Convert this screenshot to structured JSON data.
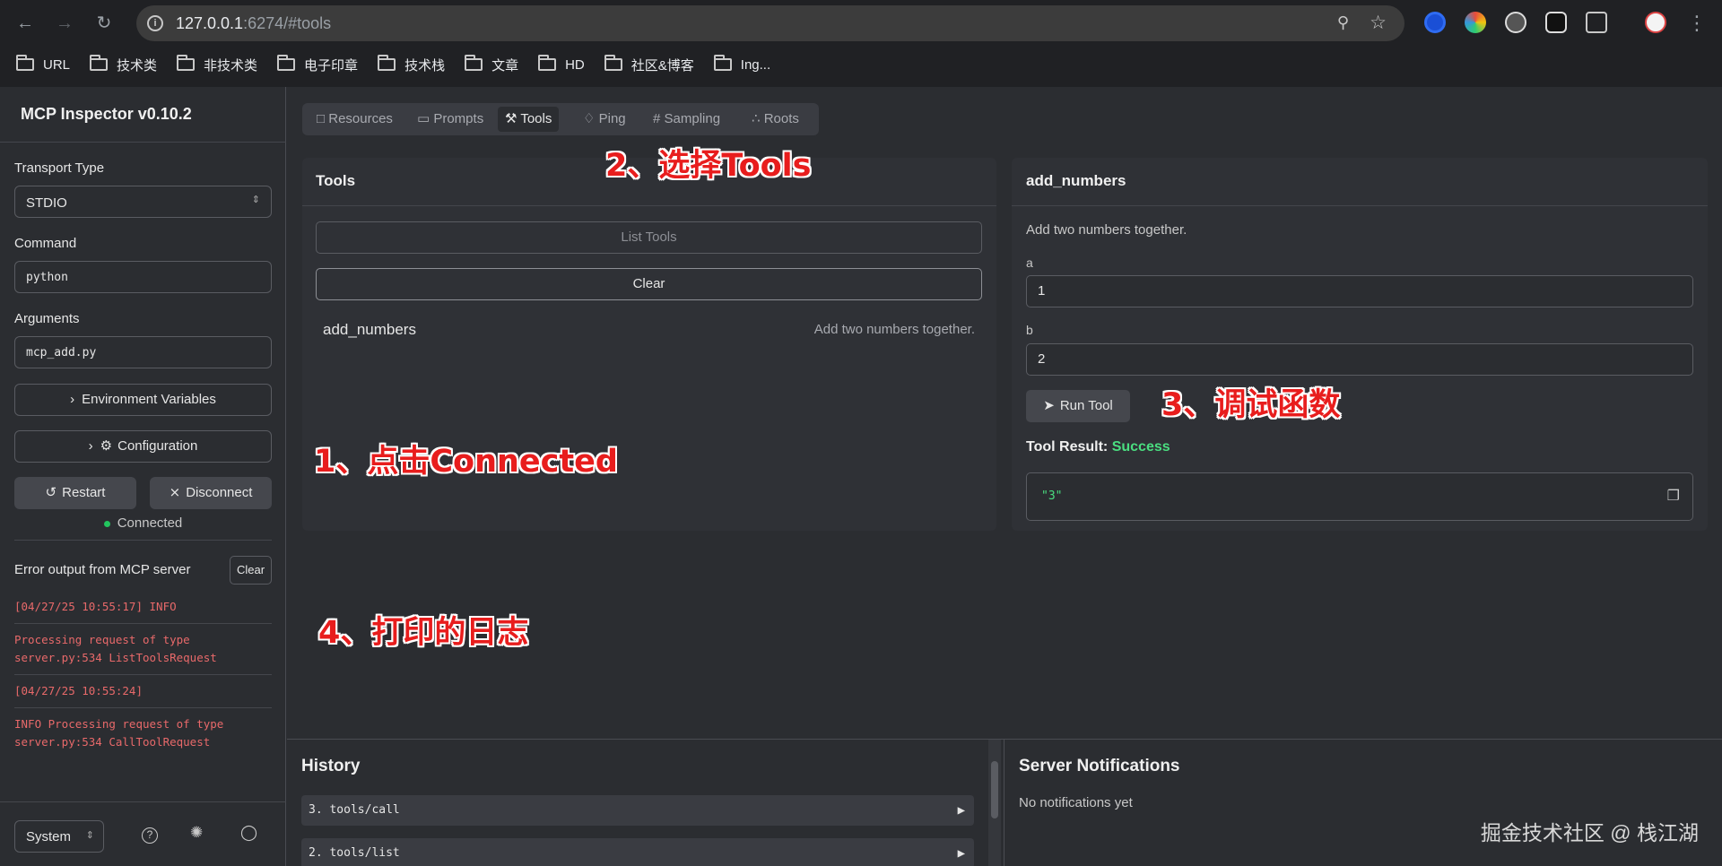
{
  "browser": {
    "url_host": "127.0.0.1",
    "url_rest": ":6274/#tools",
    "bookmarks": [
      "URL",
      "技术类",
      "非技术类",
      "电子印章",
      "技术栈",
      "文章",
      "HD",
      "社区&博客",
      "Ing..."
    ]
  },
  "sidebar": {
    "title": "MCP Inspector v0.10.2",
    "transport_label": "Transport Type",
    "transport_value": "STDIO",
    "command_label": "Command",
    "command_value": "python",
    "arguments_label": "Arguments",
    "arguments_value": "mcp_add.py",
    "env_button": "Environment Variables",
    "config_button": "Configuration",
    "restart_button": "Restart",
    "disconnect_button": "Disconnect",
    "status": "Connected",
    "error_title": "Error output from MCP server",
    "clear_button": "Clear",
    "logs": [
      "[04/27/25 10:55:17] INFO",
      "Processing request of type server.py:534 ListToolsRequest",
      "[04/27/25 10:55:24]",
      "INFO Processing request of type server.py:534 CallToolRequest"
    ],
    "theme_select": "System"
  },
  "tabs": [
    "Resources",
    "Prompts",
    "Tools",
    "Ping",
    "Sampling",
    "Roots"
  ],
  "tools_panel": {
    "title": "Tools",
    "list_button": "List Tools",
    "clear_button": "Clear",
    "tool_name": "add_numbers",
    "tool_desc": "Add two numbers together."
  },
  "detail_panel": {
    "title": "add_numbers",
    "desc": "Add two numbers together.",
    "param_a_label": "a",
    "param_a_value": "1",
    "param_b_label": "b",
    "param_b_value": "2",
    "run_button": "Run Tool",
    "result_label": "Tool Result:",
    "result_status": "Success",
    "result_value": "\"3\""
  },
  "annotations": {
    "step1": "1、点击Connected",
    "step2": "2、选择Tools",
    "step3": "3、调试函数",
    "step4": "4、打印的日志"
  },
  "history": {
    "title": "History",
    "items": [
      "3. tools/call",
      "2. tools/list"
    ]
  },
  "notifications": {
    "title": "Server Notifications",
    "empty": "No notifications yet"
  },
  "watermark": "掘金技术社区 @ 栈江湖",
  "colors": {
    "success": "#4ade80",
    "status_dot": "#22c55e",
    "log_text": "#e8696a",
    "annotation": "#e81d1d"
  }
}
